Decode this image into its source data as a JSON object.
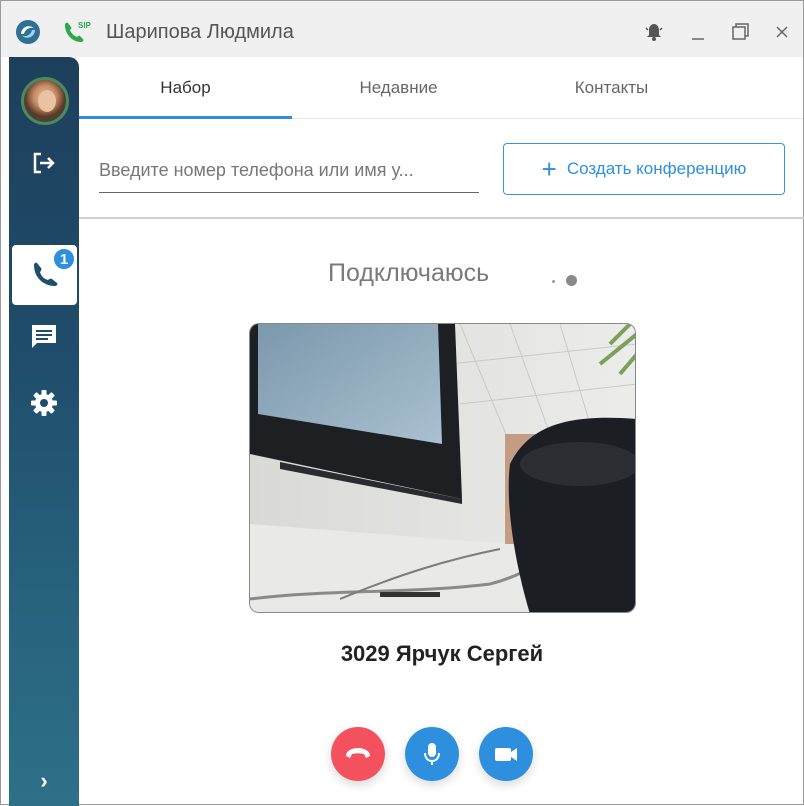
{
  "window": {
    "title": "Шарипова Людмила",
    "controls": [
      "bell-icon",
      "minimize-icon",
      "maximize-icon",
      "close-icon"
    ]
  },
  "sidebar": {
    "items": [
      {
        "name": "logout-icon",
        "active": false
      },
      {
        "name": "phone-icon",
        "active": true,
        "badge": "1"
      },
      {
        "name": "chat-icon",
        "active": false
      },
      {
        "name": "settings-icon",
        "active": false
      }
    ],
    "expand_label": "›"
  },
  "tabs": [
    {
      "label": "Набор",
      "active": true
    },
    {
      "label": "Недавние",
      "active": false
    },
    {
      "label": "Контакты",
      "active": false
    }
  ],
  "search": {
    "placeholder": "Введите номер телефона или имя у...",
    "value": ""
  },
  "conference_button": {
    "label": "Создать конференцию",
    "icon": "plus-icon"
  },
  "call": {
    "status": "Подключаюсь",
    "caller": "3029 Ярчук Сергей",
    "buttons": [
      {
        "name": "hangup-button",
        "color": "#f4515e"
      },
      {
        "name": "mute-button",
        "color": "#2d8fdd"
      },
      {
        "name": "video-button",
        "color": "#2d8fdd"
      }
    ]
  },
  "colors": {
    "accent": "#2d8fdd",
    "hangup": "#f4515e",
    "sidebar": "#1f4d6b"
  }
}
